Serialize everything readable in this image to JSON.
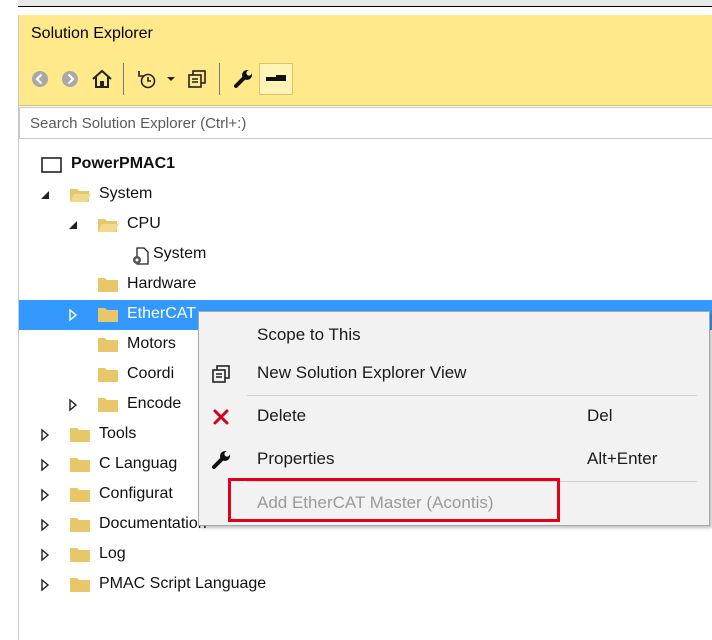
{
  "window": {
    "title": "Solution Explorer"
  },
  "toolbar": {
    "buttons": [
      {
        "name": "back-icon"
      },
      {
        "name": "forward-icon"
      },
      {
        "name": "home-icon"
      },
      {
        "name": "pending-changes-icon"
      },
      {
        "name": "dropdown-icon"
      },
      {
        "name": "new-view-icon"
      },
      {
        "name": "properties-wrench-icon"
      },
      {
        "name": "preview-selected-icon"
      }
    ]
  },
  "search": {
    "placeholder": "Search Solution Explorer (Ctrl+:)"
  },
  "tree": {
    "items": [
      {
        "label": "PowerPMAC1"
      },
      {
        "label": "System"
      },
      {
        "label": "CPU"
      },
      {
        "label": "System"
      },
      {
        "label": "Hardware"
      },
      {
        "label": "EtherCAT"
      },
      {
        "label": "Motors"
      },
      {
        "label": "Coordi"
      },
      {
        "label": "Encode"
      },
      {
        "label": "Tools"
      },
      {
        "label": "C Languag"
      },
      {
        "label": "Configurat"
      },
      {
        "label": "Documentation"
      },
      {
        "label": "Log"
      },
      {
        "label": "PMAC Script Language"
      }
    ]
  },
  "context_menu": {
    "items": [
      {
        "label": "Scope to This",
        "shortcut": ""
      },
      {
        "label": "New Solution Explorer View",
        "shortcut": ""
      },
      {
        "label": "Delete",
        "shortcut": "Del"
      },
      {
        "label": "Properties",
        "shortcut": "Alt+Enter"
      },
      {
        "label": "Add EtherCAT Master (Acontis)",
        "shortcut": "",
        "disabled": true
      }
    ]
  },
  "colors": {
    "title_bar": "#ffe98a",
    "selection": "#3399ff",
    "folder": "#e8c66a",
    "highlight": "#e3001b"
  }
}
